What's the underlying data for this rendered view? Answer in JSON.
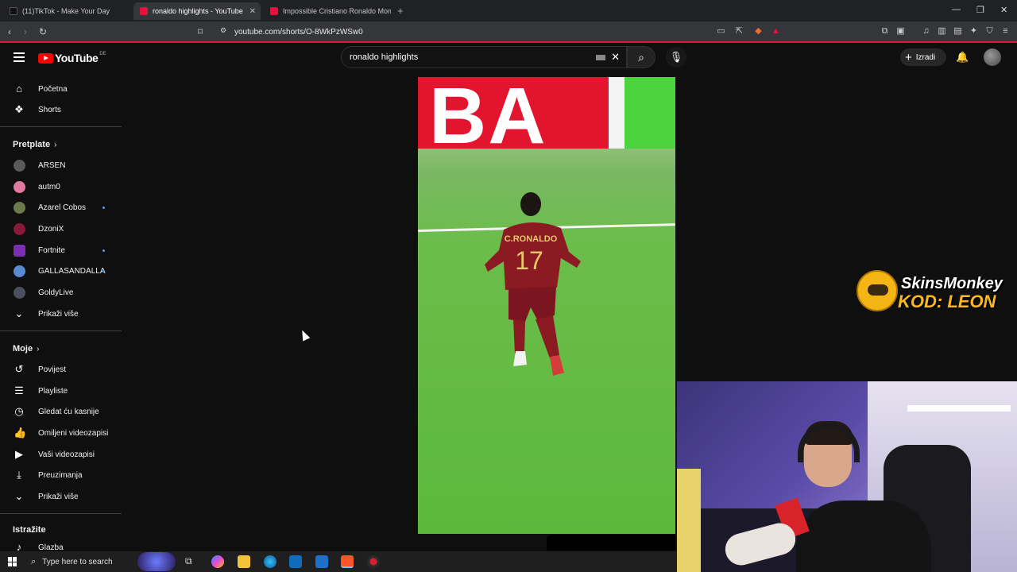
{
  "browser": {
    "tabs": [
      {
        "title": "(11)TikTok - Make Your Day",
        "active": false
      },
      {
        "title": "ronaldo highlights - YouTube",
        "active": true
      },
      {
        "title": "Impossible Cristiano Ronaldo Mome",
        "active": false
      }
    ],
    "url": "youtube.com/shorts/O-8WkPzWSw0"
  },
  "youtube": {
    "logo_text": "YouTube",
    "region": "DE",
    "search_value": "ronaldo highlights",
    "create_label": "Izradi"
  },
  "sidebar": {
    "main": [
      {
        "label": "Početna",
        "icon": "home-icon"
      },
      {
        "label": "Shorts",
        "icon": "shorts-icon"
      }
    ],
    "subscriptions_header": "Pretplate",
    "subscriptions": [
      {
        "label": "ARSEN",
        "color": "#5a5a5a",
        "new": false
      },
      {
        "label": "autm0",
        "color": "#e07aa0",
        "new": false
      },
      {
        "label": "Azarel Cobos",
        "color": "#6b7a4a",
        "new": true
      },
      {
        "label": "DzoniX",
        "color": "#8a1a3a",
        "new": false
      },
      {
        "label": "Fortnite",
        "color": "#7a2fb0",
        "new": true
      },
      {
        "label": "GALLASANDALLA",
        "color": "#5a8ad0",
        "new": true
      },
      {
        "label": "GoldyLive",
        "color": "#4a5060",
        "new": false
      }
    ],
    "show_more_1": "Prikaži više",
    "you_header": "Moje",
    "you_items": [
      {
        "label": "Povijest",
        "icon": "history-icon"
      },
      {
        "label": "Playliste",
        "icon": "playlists-icon"
      },
      {
        "label": "Gledat ću kasnije",
        "icon": "watch-later-icon"
      },
      {
        "label": "Omiljeni videozapisi",
        "icon": "liked-videos-icon"
      },
      {
        "label": "Vaši videozapisi",
        "icon": "your-videos-icon"
      },
      {
        "label": "Preuzimanja",
        "icon": "downloads-icon"
      }
    ],
    "show_more_2": "Prikaži više",
    "explore_header": "Istražite",
    "explore_items": [
      {
        "label": "Glazba",
        "icon": "music-icon"
      }
    ]
  },
  "video": {
    "banner_text": "BA",
    "jersey_name": "C.RONALDO",
    "jersey_number": "17"
  },
  "overlay": {
    "sponsor_line1": "SkinsMonkey",
    "sponsor_line2": "KOD: LEON"
  },
  "taskbar": {
    "search_placeholder": "Type here to search"
  }
}
